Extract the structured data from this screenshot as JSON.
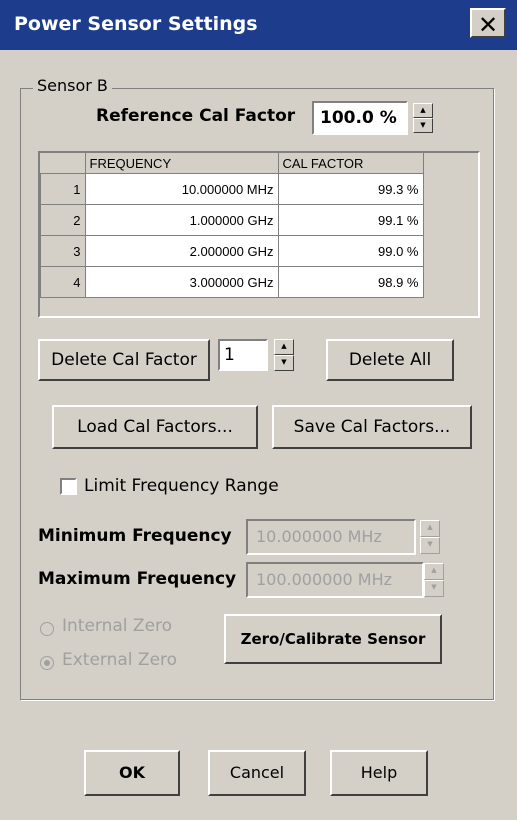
{
  "window": {
    "title": "Power Sensor Settings",
    "close_glyph": "✕"
  },
  "group": {
    "label": "Sensor B"
  },
  "reference": {
    "label": "Reference Cal Factor",
    "value": "100.0 %"
  },
  "table": {
    "headers": [
      "FREQUENCY",
      "CAL FACTOR"
    ],
    "rows": [
      {
        "index": "1",
        "frequency": "10.000000 MHz",
        "cal_factor": "99.3 %"
      },
      {
        "index": "2",
        "frequency": "1.000000 GHz",
        "cal_factor": "99.1 %"
      },
      {
        "index": "3",
        "frequency": "2.000000 GHz",
        "cal_factor": "99.0 %"
      },
      {
        "index": "4",
        "frequency": "3.000000 GHz",
        "cal_factor": "98.9 %"
      }
    ]
  },
  "buttons": {
    "delete_cal_factor": "Delete Cal Factor",
    "delete_index": "1",
    "delete_all": "Delete All",
    "load": "Load Cal Factors...",
    "save": "Save Cal Factors...",
    "zero_calibrate": "Zero/Calibrate Sensor",
    "ok": "OK",
    "cancel": "Cancel",
    "help": "Help"
  },
  "limit": {
    "label": "Limit Frequency Range",
    "checked": false
  },
  "min_freq": {
    "label": "Minimum Frequency",
    "value": "10.000000 MHz"
  },
  "max_freq": {
    "label": "Maximum Frequency",
    "value": "100.000000 MHz"
  },
  "zero": {
    "internal": "Internal Zero",
    "external": "External Zero",
    "selected": "External Zero"
  },
  "spinner_glyphs": {
    "up": "▲",
    "down": "▼"
  }
}
